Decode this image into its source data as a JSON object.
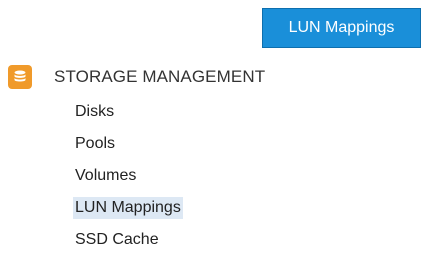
{
  "top_tab": {
    "label": "LUN Mappings"
  },
  "storage_management": {
    "title": "STORAGE MANAGEMENT",
    "icon": "storage-icon",
    "accent_color": "#f09a2a",
    "items": [
      {
        "label": "Disks"
      },
      {
        "label": "Pools"
      },
      {
        "label": "Volumes"
      },
      {
        "label": "LUN Mappings",
        "selected": true
      },
      {
        "label": "SSD Cache"
      }
    ]
  },
  "colors": {
    "tab_background": "#1a8fd9",
    "selected_highlight": "#dde8f4"
  }
}
